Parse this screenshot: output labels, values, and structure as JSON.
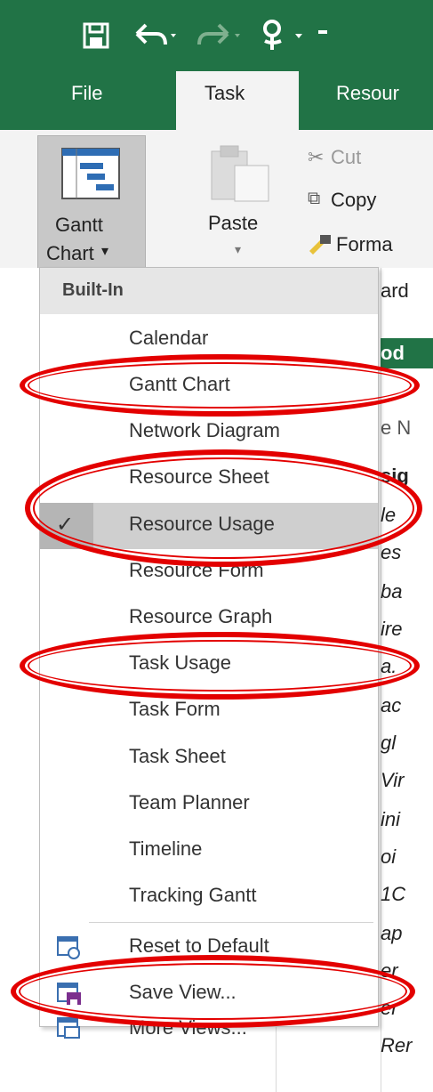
{
  "quick_access": {
    "save_icon": "save-icon",
    "undo_icon": "undo-icon",
    "redo_icon": "redo-icon",
    "touch_icon": "touch-mode-icon"
  },
  "tabs": {
    "file": "File",
    "task": "Task",
    "resource": "Resour"
  },
  "ribbon": {
    "gantt_line1": "Gantt",
    "gantt_line2": "Chart",
    "paste": "Paste",
    "cut": "Cut",
    "copy": "Copy",
    "format": "Forma"
  },
  "menu": {
    "header": "Built-In",
    "items": [
      {
        "label": "Calendar"
      },
      {
        "label": "Gantt Chart"
      },
      {
        "label": "Network Diagram"
      },
      {
        "label": "Resource Sheet"
      },
      {
        "label": "Resource Usage"
      },
      {
        "label": "Resource Form"
      },
      {
        "label": "Resource Graph"
      },
      {
        "label": "Task Usage"
      },
      {
        "label": "Task Form"
      },
      {
        "label": "Task Sheet"
      },
      {
        "label": "Team Planner"
      },
      {
        "label": "Timeline"
      },
      {
        "label": "Tracking Gantt"
      }
    ],
    "actions": [
      {
        "label": "Reset to Default"
      },
      {
        "label": "Save View..."
      },
      {
        "label": "More Views..."
      }
    ]
  },
  "background_rows": [
    "ard",
    "od",
    "e N",
    "sig",
    "le",
    "es",
    "ba",
    "ire",
    "a.",
    "ac",
    "gl",
    "Vir",
    "ini",
    "oi",
    "1C",
    "ap",
    "er",
    "er",
    "Rer"
  ],
  "colors": {
    "title_green": "#217346",
    "highlight_red": "#e30000"
  }
}
